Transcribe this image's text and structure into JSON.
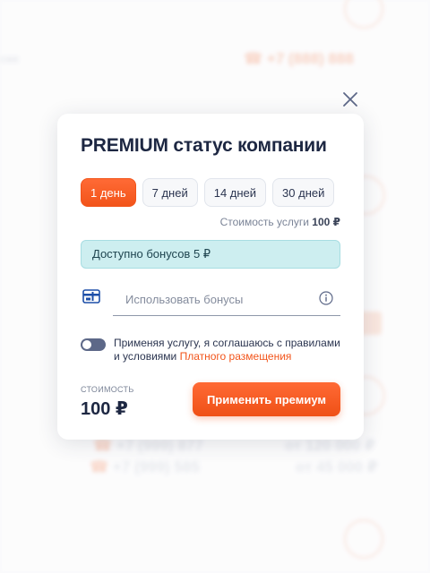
{
  "background": {
    "phone_top": "+7 (888) 888",
    "phone_a": "+7 (999) 877",
    "phone_b": "+7 (999) 585",
    "price_a": "от 120 000 ₽",
    "price_b": "от 45 000 ₽"
  },
  "modal": {
    "title": "PREMIUM статус компании",
    "periods": [
      "1 день",
      "7 дней",
      "14 дней",
      "30 дней"
    ],
    "selected_period": "1 день",
    "service_cost_label": "Стоимость услуги",
    "service_cost_value": "100 ₽",
    "bonus_available": "Доступно бонусов 5 ₽",
    "bonus_input_placeholder": "Использовать бонусы",
    "agreement_text": "Применяя услугу, я соглашаюсь с правилами и условиями",
    "agreement_link": "Платного размещения",
    "cost_label": "СТОИМОСТЬ",
    "cost_value": "100 ₽",
    "apply_label": "Применить премиум"
  },
  "colors": {
    "accent": "#f2541a",
    "title": "#1d2742",
    "bonus_bg": "#cdeef0"
  },
  "icons": {
    "close": "close-icon",
    "card": "credit-card-icon",
    "info": "info-icon"
  }
}
